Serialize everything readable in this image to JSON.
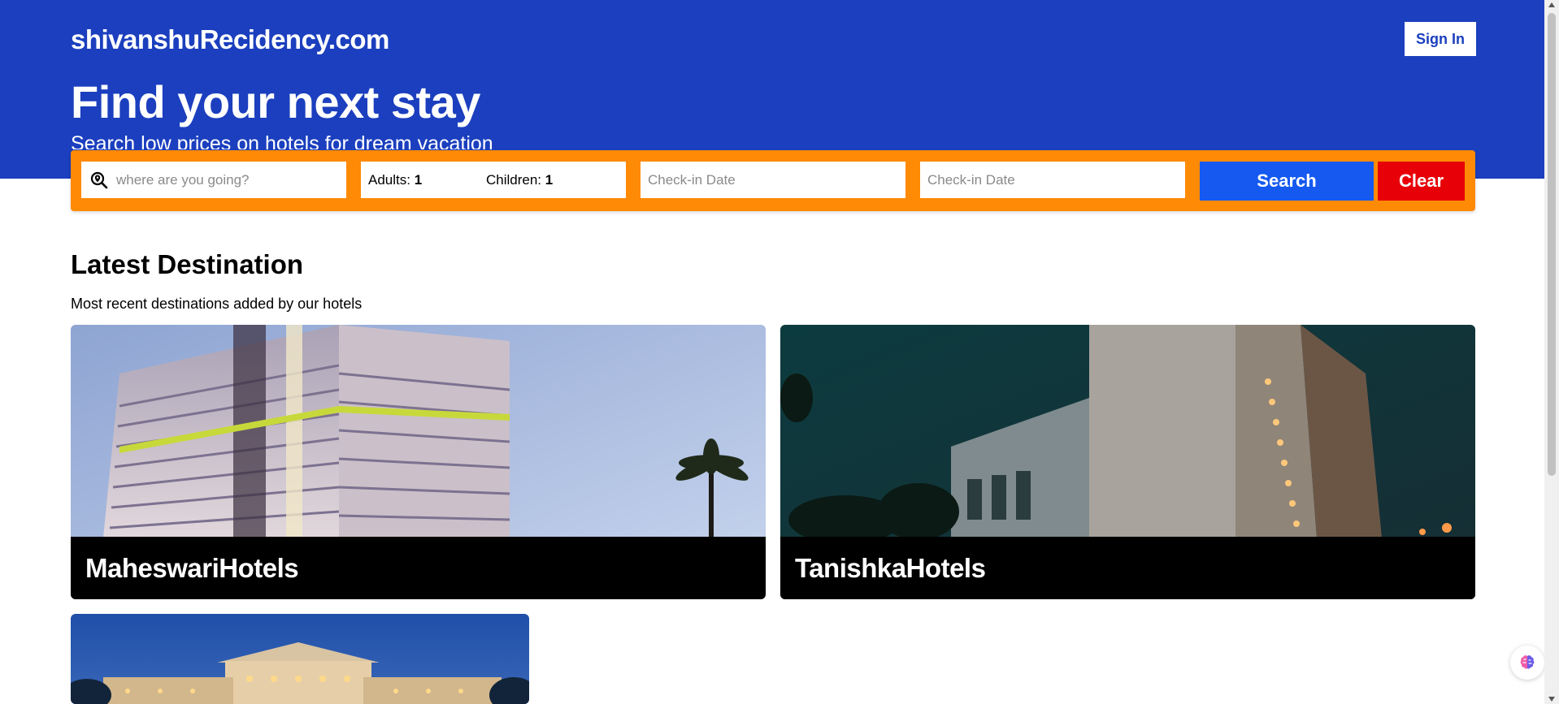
{
  "header": {
    "brand": "shivanshuRecidency.com",
    "sign_in_label": "Sign In",
    "hero_title": "Find your next stay",
    "hero_subtitle": "Search low prices on hotels for dream vacation"
  },
  "search": {
    "destination_placeholder": "where are you going?",
    "adults_label": "Adults:",
    "adults_value": "1",
    "children_label": "Children:",
    "children_value": "1",
    "checkin_placeholder": "Check-in Date",
    "checkout_placeholder": "Check-in Date",
    "search_label": "Search",
    "clear_label": "Clear"
  },
  "latest": {
    "title": "Latest Destination",
    "subtitle": "Most recent destinations added by our hotels",
    "cards": [
      {
        "name": "MaheswariHotels"
      },
      {
        "name": "TanishkaHotels"
      },
      {
        "name": ""
      }
    ]
  },
  "colors": {
    "header_bg": "#1b3fbe",
    "search_bar_bg": "#ff8a05",
    "search_button": "#1559f0",
    "clear_button": "#e70008"
  },
  "icons": {
    "destination": "search-location-icon",
    "floating_assistant": "brain-icon"
  }
}
